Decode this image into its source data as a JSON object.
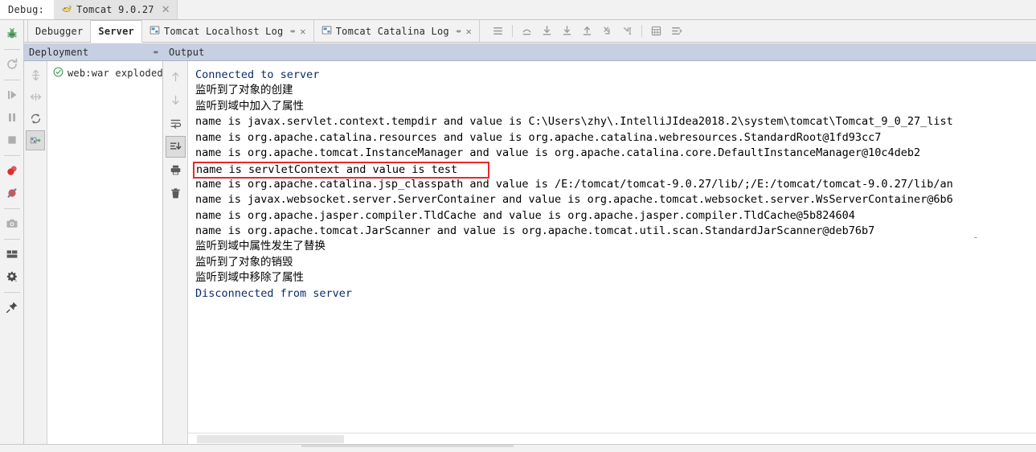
{
  "titlebar": {
    "debug_label": "Debug:",
    "session_tab": "Tomcat 9.0.27",
    "session_icon": "tomcat-icon",
    "close_icon": "close-icon"
  },
  "left_rail": {
    "items": [
      {
        "name": "debug-bug-icon",
        "glyph": "bug"
      },
      {
        "name": "rerun-icon",
        "glyph": "rerun"
      },
      {
        "name": "resume-program-icon",
        "glyph": "resume"
      },
      {
        "name": "pause-program-icon",
        "glyph": "pause"
      },
      {
        "name": "stop-icon",
        "glyph": "stop"
      },
      {
        "name": "view-breakpoints-icon",
        "glyph": "breakpoints"
      },
      {
        "name": "mute-breakpoints-icon",
        "glyph": "mute-breakpoints"
      },
      {
        "name": "screenshot-icon",
        "glyph": "camera"
      },
      {
        "name": "layout-settings-icon",
        "glyph": "layout"
      },
      {
        "name": "settings-gear-icon",
        "glyph": "gear"
      },
      {
        "name": "pin-tab-icon",
        "glyph": "pin"
      }
    ]
  },
  "tabs": [
    {
      "label": "Debugger",
      "active": false,
      "icon": null,
      "pin": false,
      "close": false
    },
    {
      "label": "Server",
      "active": true,
      "icon": null,
      "pin": false,
      "close": false
    },
    {
      "label": "Tomcat Localhost Log",
      "active": false,
      "icon": "console-icon",
      "pin": true,
      "close": true
    },
    {
      "label": "Tomcat Catalina Log",
      "active": false,
      "icon": "console-icon",
      "pin": true,
      "close": true
    }
  ],
  "debug_toolbar": {
    "buttons": [
      {
        "name": "show-execution-point-icon",
        "glyph": "lines"
      },
      {
        "name": "step-over-icon",
        "glyph": "step-over"
      },
      {
        "name": "step-into-icon",
        "glyph": "step-into"
      },
      {
        "name": "force-step-into-icon",
        "glyph": "force-step-into"
      },
      {
        "name": "step-out-icon",
        "glyph": "step-out"
      },
      {
        "name": "drop-frame-icon",
        "glyph": "drop-frame"
      },
      {
        "name": "run-to-cursor-icon",
        "glyph": "run-to-cursor"
      },
      {
        "name": "evaluate-expression-icon",
        "glyph": "evaluate"
      },
      {
        "name": "trace-current-stream-icon",
        "glyph": "trace-stream"
      }
    ]
  },
  "panels": {
    "deployment": {
      "header": "Deployment",
      "pin_icon": "pin-icon",
      "rail": [
        {
          "name": "expand-all-icon",
          "glyph": "expand-all",
          "selected": false
        },
        {
          "name": "collapse-all-icon",
          "glyph": "collapse-all",
          "selected": false
        },
        {
          "name": "redeploy-icon",
          "glyph": "refresh",
          "selected": false
        },
        {
          "name": "deploy-artifact-icon",
          "glyph": "deploy",
          "selected": true
        }
      ],
      "tree": [
        {
          "label": "web:war exploded",
          "status_icon": "success-check-icon"
        }
      ]
    },
    "output": {
      "header": "Output",
      "rail": [
        {
          "name": "scroll-up-icon",
          "glyph": "arrow-up",
          "selected": false
        },
        {
          "name": "scroll-down-icon",
          "glyph": "arrow-down",
          "selected": false
        },
        {
          "name": "soft-wrap-icon",
          "glyph": "soft-wrap",
          "selected": false
        },
        {
          "name": "scroll-to-end-icon",
          "glyph": "scroll-to-end",
          "selected": true
        },
        {
          "name": "print-icon",
          "glyph": "printer",
          "selected": false
        },
        {
          "name": "clear-all-icon",
          "glyph": "trash",
          "selected": false
        }
      ]
    }
  },
  "console": {
    "lines": [
      {
        "text": "Connected to server",
        "style": "link"
      },
      {
        "text": "监听到了对象的创建",
        "style": "cjk"
      },
      {
        "text": "监听到域中加入了属性",
        "style": "cjk"
      },
      {
        "text": "name is javax.servlet.context.tempdir and value is C:\\Users\\zhy\\.IntelliJIdea2018.2\\system\\tomcat\\Tomcat_9_0_27_list",
        "style": "plain"
      },
      {
        "text": "name is org.apache.catalina.resources and value is org.apache.catalina.webresources.StandardRoot@1fd93cc7",
        "style": "plain"
      },
      {
        "text": "name is org.apache.tomcat.InstanceManager and value is org.apache.catalina.core.DefaultInstanceManager@10c4deb2",
        "style": "plain"
      },
      {
        "text": "name is servletContext and value is test",
        "style": "boxed"
      },
      {
        "text": "name is org.apache.catalina.jsp_classpath and value is /E:/tomcat/tomcat-9.0.27/lib/;/E:/tomcat/tomcat-9.0.27/lib/an",
        "style": "plain"
      },
      {
        "text": "name is javax.websocket.server.ServerContainer and value is org.apache.tomcat.websocket.server.WsServerContainer@6b6",
        "style": "plain"
      },
      {
        "text": "name is org.apache.jasper.compiler.TldCache and value is org.apache.jasper.compiler.TldCache@5b824604",
        "style": "plain"
      },
      {
        "text": "name is org.apache.tomcat.JarScanner and value is org.apache.tomcat.util.scan.StandardJarScanner@deb76b7",
        "style": "plain"
      },
      {
        "text": "监听到域中属性发生了替换",
        "style": "cjk"
      },
      {
        "text": "监听到了对象的销毁",
        "style": "cjk"
      },
      {
        "text": "监听到域中移除了属性",
        "style": "cjk"
      },
      {
        "text": "Disconnected from server",
        "style": "link"
      }
    ],
    "highlight_color": "#e8282a",
    "highlighted_line_index": 6
  },
  "scrollbar": {
    "name": "horizontal-scrollbar"
  },
  "colors": {
    "panel_header_bg": "#c7d0e2",
    "chrome_bg": "#f2f2f2",
    "console_bg": "#ffffff",
    "text": "#000000",
    "link_text": "#0d2b6b",
    "accent_red": "#e8282a",
    "success_green": "#59a869"
  }
}
